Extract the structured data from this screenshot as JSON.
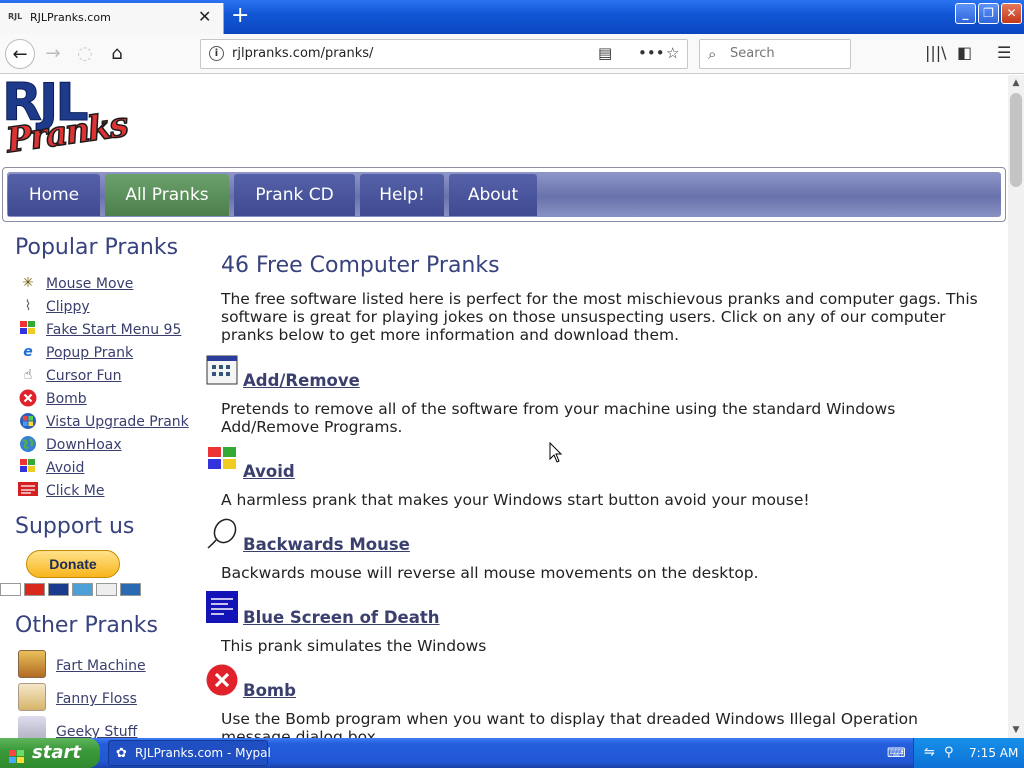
{
  "browser": {
    "tab_favicon": "RJL",
    "tab_title": "RJLPranks.com",
    "new_tab_icon": "+",
    "url": "rjlpranks.com/pranks/",
    "search_placeholder": "Search"
  },
  "site": {
    "logo_top": "RJL",
    "logo_bottom": "Pranks",
    "nav": [
      "Home",
      "All Pranks",
      "Prank CD",
      "Help!",
      "About"
    ],
    "active_nav": "All Pranks"
  },
  "sidebar": {
    "popular_heading": "Popular Pranks",
    "popular": [
      {
        "label": "Mouse Move",
        "icon": "mouse-move-icon"
      },
      {
        "label": "Clippy",
        "icon": "paperclip-icon"
      },
      {
        "label": "Fake Start Menu 95",
        "icon": "windows-flag-icon"
      },
      {
        "label": "Popup Prank",
        "icon": "internet-explorer-icon"
      },
      {
        "label": "Cursor Fun",
        "icon": "cursor-hand-icon"
      },
      {
        "label": "Bomb",
        "icon": "red-x-icon"
      },
      {
        "label": "Vista Upgrade Prank",
        "icon": "vista-orb-icon"
      },
      {
        "label": "DownHoax",
        "icon": "globe-icon"
      },
      {
        "label": "Avoid",
        "icon": "windows-flag-icon"
      },
      {
        "label": "Click Me",
        "icon": "click-here-icon"
      }
    ],
    "support_heading": "Support us",
    "donate_label": "Donate",
    "other_heading": "Other Pranks",
    "other": [
      {
        "label": "Fart Machine",
        "icon": "fart-machine-box-icon"
      },
      {
        "label": "Fanny Floss",
        "icon": "fanny-floss-box-icon"
      },
      {
        "label": "Geeky Stuff",
        "icon": "geeky-stuff-icon"
      }
    ]
  },
  "main": {
    "title": "46 Free Computer Pranks",
    "intro": "The free software listed here is perfect for the most mischievous pranks and computer gags. This software is great for playing jokes on those unsuspecting users. Click on any of our computer pranks below to get more information and download them.",
    "pranks": [
      {
        "name": "Add/Remove",
        "desc": "Pretends to remove all of the software from your machine using the standard Windows Add/Remove Programs.",
        "icon": "add-remove-programs-icon"
      },
      {
        "name": "Avoid",
        "desc": "A harmless prank that makes your Windows start button avoid your mouse!",
        "icon": "windows-flag-icon"
      },
      {
        "name": "Backwards Mouse",
        "desc": "Backwards mouse will reverse all mouse movements on the desktop.",
        "icon": "mouse-icon"
      },
      {
        "name": "Blue Screen of Death",
        "desc": "This prank simulates the Windows",
        "icon": "blue-screen-icon"
      },
      {
        "name": "Bomb",
        "desc": "Use the Bomb program when you want to display that dreaded Windows Illegal Operation message dialog box.",
        "icon": "red-x-icon"
      }
    ]
  },
  "taskbar": {
    "start_label": "start",
    "task_item": "RJLPranks.com - Mypal",
    "clock": "7:15 AM"
  }
}
